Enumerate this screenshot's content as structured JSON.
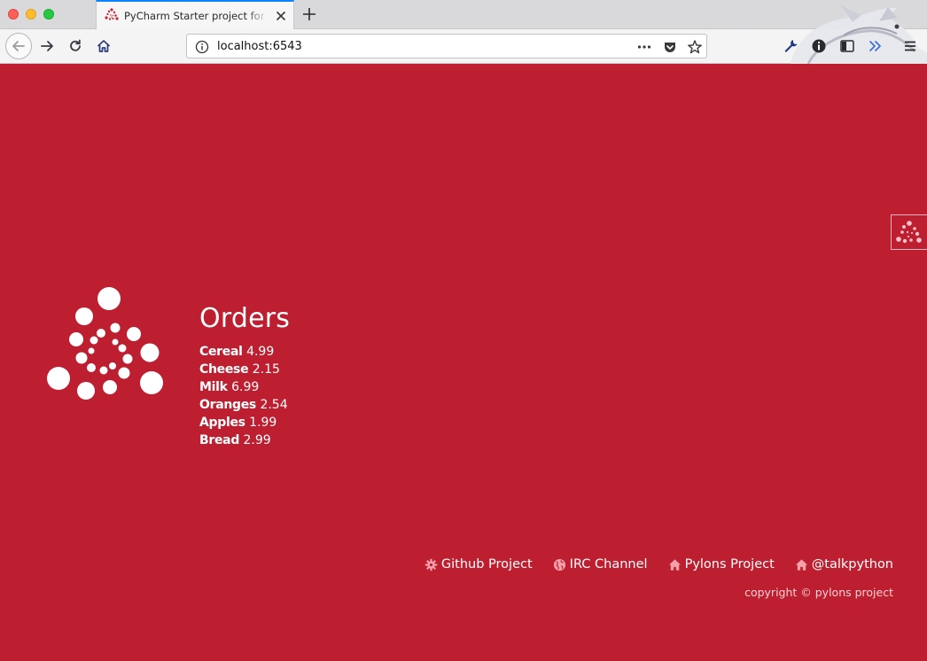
{
  "browser": {
    "tab_title": "PyCharm Starter project for the",
    "url": "localhost:6543",
    "favicon": "pyramid-logo-icon"
  },
  "orders": {
    "title": "Orders",
    "items": [
      {
        "name": "Cereal",
        "price": "4.99"
      },
      {
        "name": "Cheese",
        "price": "2.15"
      },
      {
        "name": "Milk",
        "price": "6.99"
      },
      {
        "name": "Oranges",
        "price": "2.54"
      },
      {
        "name": "Apples",
        "price": "1.99"
      },
      {
        "name": "Bread",
        "price": "2.99"
      }
    ]
  },
  "footer": {
    "links": [
      {
        "label": "Github Project",
        "icon": "gear-icon"
      },
      {
        "label": "IRC Channel",
        "icon": "globe-icon"
      },
      {
        "label": "Pylons Project",
        "icon": "home-icon"
      },
      {
        "label": "@talkpython",
        "icon": "home-icon"
      }
    ],
    "copyright": "copyright © pylons project"
  },
  "colors": {
    "background": "#bd1f30",
    "text": "#ffffff",
    "icon": "#f3a2ab"
  }
}
